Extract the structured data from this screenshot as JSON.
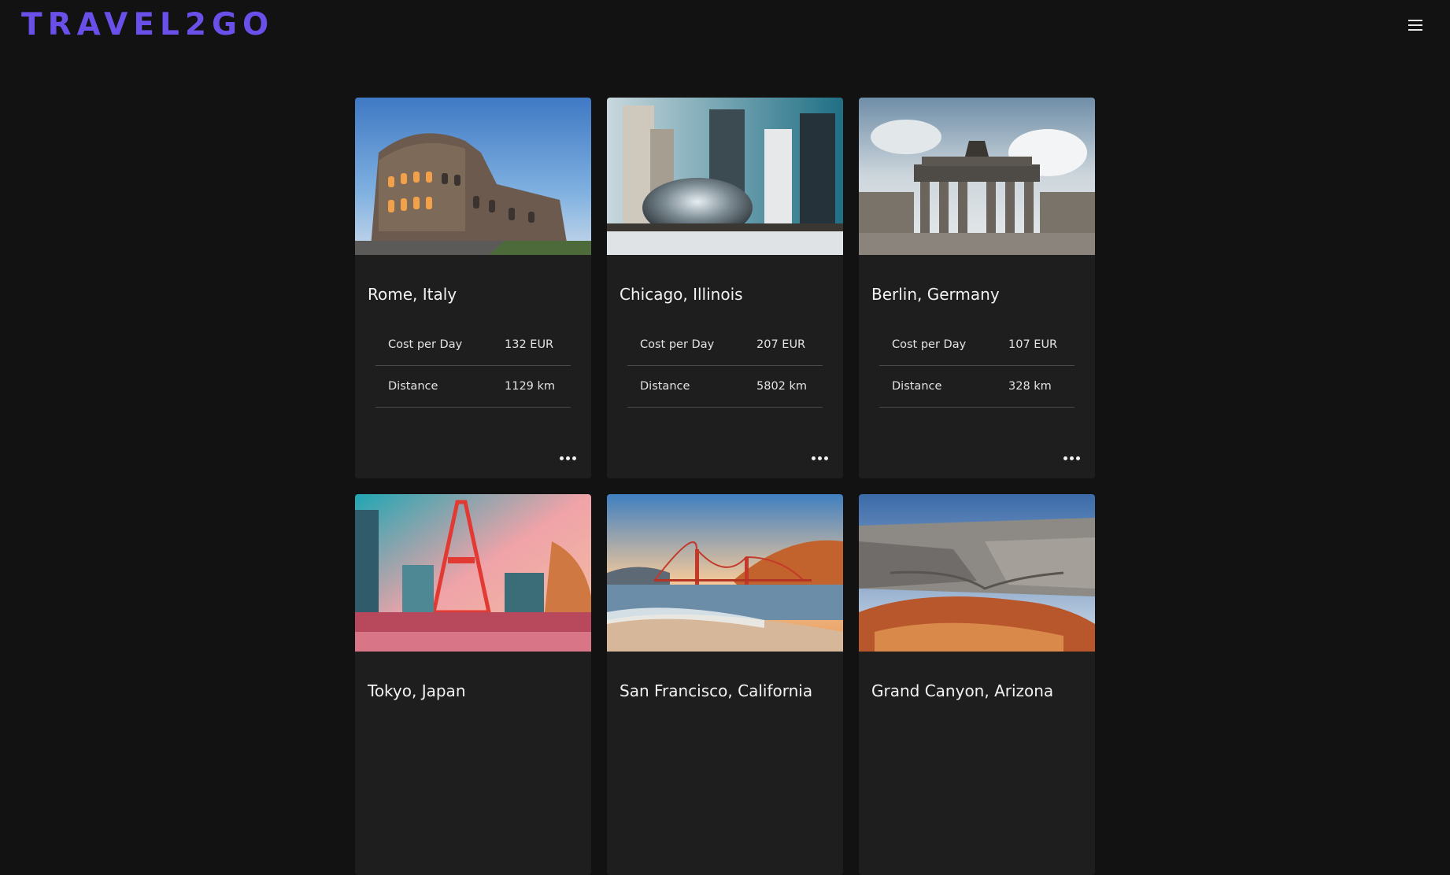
{
  "header": {
    "logo": "TRAVEL2GO",
    "menu_icon": "hamburger-menu-icon"
  },
  "cards": [
    {
      "title": "Rome, Italy",
      "image_icon": "colosseum-photo",
      "stats": [
        {
          "label": "Cost per Day",
          "value": "132 EUR"
        },
        {
          "label": "Distance",
          "value": "1129 km"
        }
      ]
    },
    {
      "title": "Chicago, Illinois",
      "image_icon": "cloud-gate-photo",
      "stats": [
        {
          "label": "Cost per Day",
          "value": "207 EUR"
        },
        {
          "label": "Distance",
          "value": "5802 km"
        }
      ]
    },
    {
      "title": "Berlin, Germany",
      "image_icon": "brandenburg-gate-photo",
      "stats": [
        {
          "label": "Cost per Day",
          "value": "107 EUR"
        },
        {
          "label": "Distance",
          "value": "328 km"
        }
      ]
    },
    {
      "title": "Tokyo, Japan",
      "image_icon": "tokyo-tower-photo"
    },
    {
      "title": "San Francisco, California",
      "image_icon": "golden-gate-bridge-photo"
    },
    {
      "title": "Grand Canyon, Arizona",
      "image_icon": "grand-canyon-photo"
    }
  ],
  "colors": {
    "background": "#121212",
    "card": "#1e1e1e",
    "logo": "#6a4fe8",
    "divider": "#4a4a4a"
  }
}
